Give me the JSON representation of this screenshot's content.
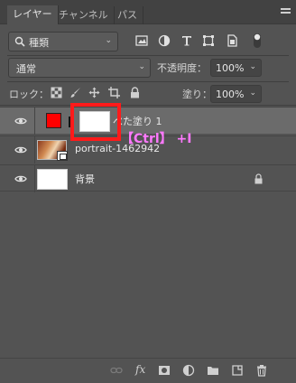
{
  "tabs": [
    {
      "label": "レイヤー",
      "active": true
    },
    {
      "label": "チャンネル",
      "active": false
    },
    {
      "label": "パス",
      "active": false
    }
  ],
  "filter": {
    "label": "種類"
  },
  "blend_mode": {
    "label": "通常"
  },
  "opacity": {
    "label": "不透明度：",
    "value": "100%"
  },
  "lock": {
    "label": "ロック："
  },
  "fill": {
    "label": "塗り：",
    "value": "100%"
  },
  "layers": [
    {
      "name": "べた塗り 1",
      "selected": true,
      "swatch_color": "#ff0000"
    },
    {
      "name": "portrait-1462942",
      "selected": false
    },
    {
      "name": "背景",
      "selected": false
    }
  ],
  "annotation": {
    "text": "【Ctrl】 +I",
    "color": "#ff79ff",
    "box_color": "#ff1a1a"
  },
  "bottom_bar": {
    "fx_label": "fx"
  },
  "colors": {
    "panel_bg": "#535353",
    "tabbar_bg": "#424242",
    "selected_row": "#6b6b6b"
  }
}
